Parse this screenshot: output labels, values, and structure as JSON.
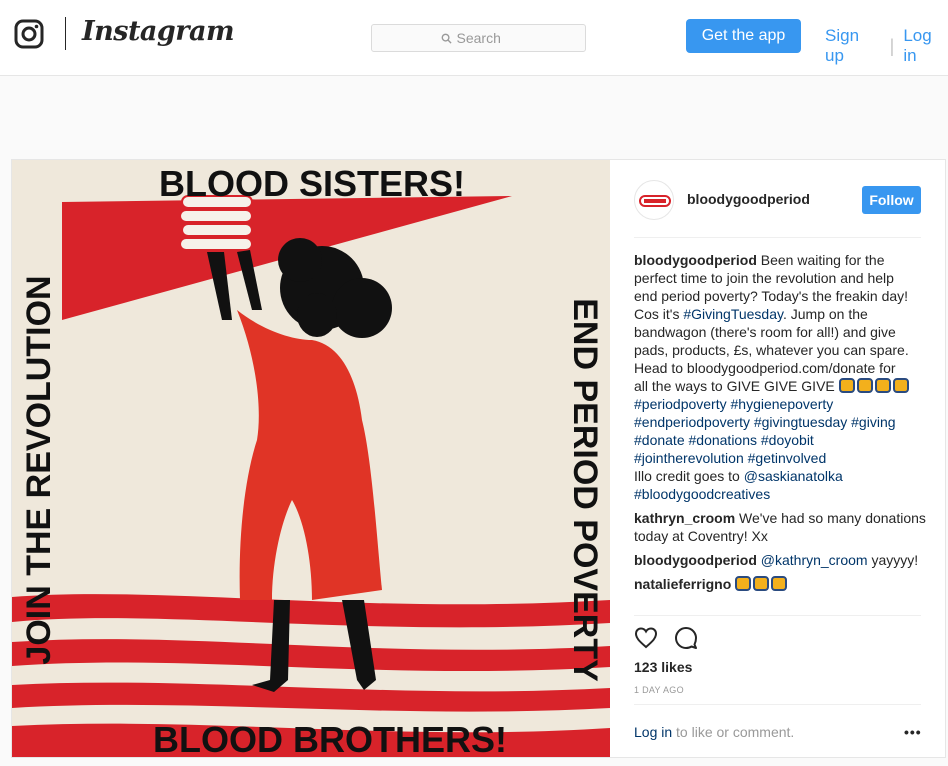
{
  "header": {
    "logo_text": "Instagram",
    "search_placeholder": "Search",
    "get_app_label": "Get the app",
    "sign_up_label": "Sign up",
    "separator": "|",
    "log_in_label": "Log in"
  },
  "post": {
    "image": {
      "top_text": "BLOOD SISTERS!",
      "bottom_text": "BLOOD BROTHERS!",
      "left_text": "JOIN THE REVOLUTION",
      "right_text": "END PERIOD POVERTY"
    },
    "username": "bloodygoodperiod",
    "follow_label": "Follow",
    "caption": {
      "username": "bloodygoodperiod",
      "lines": [
        " Been waiting for the",
        "perfect time to join the revolution and help",
        "end period poverty? Today's the freakin day!",
        "Cos it's "
      ],
      "tag_givingtuesday": "#GivingTuesday",
      "line4_tail": ". Jump on the",
      "lines_b": [
        "bandwagon (there's room for all!) and give",
        "pads, products, £s, whatever you can spare.",
        "Head to bloodygoodperiod.com/donate for",
        "all the ways to GIVE GIVE GIVE "
      ],
      "hashtag_lines": [
        "#periodpoverty #hygienepoverty",
        "#endperiodpoverty #givingtuesday #giving",
        "#donate #donations #doyobit",
        "#jointherevolution #getinvolved"
      ],
      "credit_text": "Illo credit goes to ",
      "credit_handle": "@saskianatolka",
      "last_tag": "#bloodygoodcreatives"
    },
    "comments": [
      {
        "username": "kathryn_croom",
        "text_1": " We've had so many donations",
        "text_2": "today at Coventry! Xx"
      },
      {
        "username": "bloodygoodperiod",
        "mention": "@kathryn_croom",
        "text": " yayyyy!"
      },
      {
        "username": "natalieferrigno"
      }
    ],
    "icons": {
      "like": "heart-icon",
      "comment": "comment-icon",
      "more": "more-options-icon"
    },
    "likes_text": "123 likes",
    "timestamp": "1 DAY AGO",
    "login_prompt": {
      "link": "Log in",
      "text": " to like or comment."
    },
    "more_label": "•••",
    "colors": {
      "accent": "#3897f0",
      "link": "#003569",
      "poster_red": "#e03426",
      "poster_bg": "#efe8db"
    }
  }
}
